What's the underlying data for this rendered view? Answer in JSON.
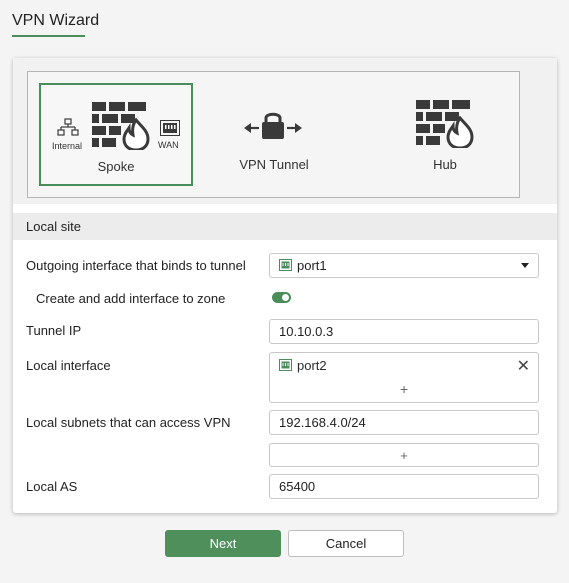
{
  "wizard": {
    "title": "VPN Wizard"
  },
  "topology": {
    "spoke": {
      "label": "Spoke",
      "left_tag": "Internal",
      "right_tag": "WAN"
    },
    "tunnel": {
      "label": "VPN Tunnel"
    },
    "hub": {
      "label": "Hub"
    }
  },
  "local_site": {
    "section_title": "Local site",
    "outgoing_interface": {
      "label": "Outgoing interface that binds to tunnel",
      "value": "port1"
    },
    "zone_toggle": {
      "label": "Create and add interface to zone",
      "enabled": true
    },
    "tunnel_ip": {
      "label": "Tunnel IP",
      "value": "10.10.0.3"
    },
    "local_interface": {
      "label": "Local interface",
      "value": "port2",
      "add_symbol": "+"
    },
    "local_subnets": {
      "label": "Local subnets that can access VPN",
      "value": "192.168.4.0/24",
      "add_symbol": "+"
    },
    "local_as": {
      "label": "Local AS",
      "value": "65400"
    }
  },
  "buttons": {
    "next": "Next",
    "cancel": "Cancel"
  },
  "colors": {
    "accent": "#4a8c5a",
    "icon_dark": "#3a3a3a"
  },
  "icons": [
    "firewall-icon",
    "flame-icon",
    "network-tree-icon",
    "wan-port-icon",
    "lock-icon",
    "port-icon",
    "close-icon"
  ]
}
